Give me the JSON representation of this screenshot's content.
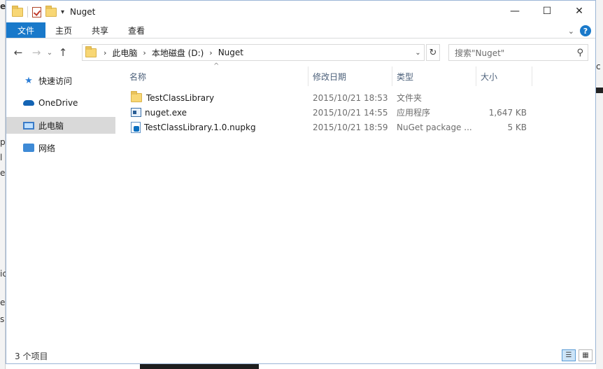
{
  "window": {
    "title": "Nuget"
  },
  "titlebar": {
    "dropdown_glyph": "▾",
    "min_glyph": "—",
    "max_glyph": "☐",
    "close_glyph": "✕"
  },
  "ribbon": {
    "tabs": [
      {
        "label": "文件"
      },
      {
        "label": "主页"
      },
      {
        "label": "共享"
      },
      {
        "label": "查看"
      }
    ],
    "expand_glyph": "⌄",
    "help_glyph": "?"
  },
  "nav": {
    "back_glyph": "←",
    "forward_glyph": "→",
    "recent_glyph": "⌄",
    "up_glyph": "↑",
    "refresh_glyph": "↻",
    "crumb_sep": "›",
    "breadcrumbs": [
      "此电脑",
      "本地磁盘 (D:)",
      "Nuget"
    ],
    "address_dropdown_glyph": "⌄",
    "search_placeholder": "搜索\"Nuget\"",
    "search_glyph": "⚲"
  },
  "sidebar": {
    "items": [
      {
        "label": "快速访问",
        "icon": "star-icon"
      },
      {
        "label": "OneDrive",
        "icon": "cloud-icon"
      },
      {
        "label": "此电脑",
        "icon": "computer-icon",
        "selected": true
      },
      {
        "label": "网络",
        "icon": "network-icon"
      }
    ],
    "star_glyph": "★"
  },
  "file_list": {
    "columns": {
      "name": "名称",
      "modified": "修改日期",
      "type": "类型",
      "size": "大小"
    },
    "sort_glyph": "^",
    "rows": [
      {
        "name": "TestClassLibrary",
        "modified": "2015/10/21 18:53",
        "type": "文件夹",
        "size": "",
        "icon": "folder-icon"
      },
      {
        "name": "nuget.exe",
        "modified": "2015/10/21 14:55",
        "type": "应用程序",
        "size": "1,647 KB",
        "icon": "exe-icon"
      },
      {
        "name": "TestClassLibrary.1.0.nupkg",
        "modified": "2015/10/21 18:59",
        "type": "NuGet package ...",
        "size": "5 KB",
        "icon": "nupkg-icon"
      }
    ]
  },
  "statusbar": {
    "item_count": "3 个项目",
    "details_glyph": "☰",
    "tiles_glyph": "▦"
  },
  "background": {
    "glyph_e1": "e",
    "glyph_p": "p",
    "glyph_l": "l",
    "glyph_e2": "e",
    "glyph_ic": "ic",
    "glyph_e3": "e",
    "glyph_s": "s",
    "glyph_c": "c"
  },
  "colors": {
    "accent": "#1979ca",
    "selected_nav": "#d9d9d9",
    "header_text": "#4c607a"
  }
}
